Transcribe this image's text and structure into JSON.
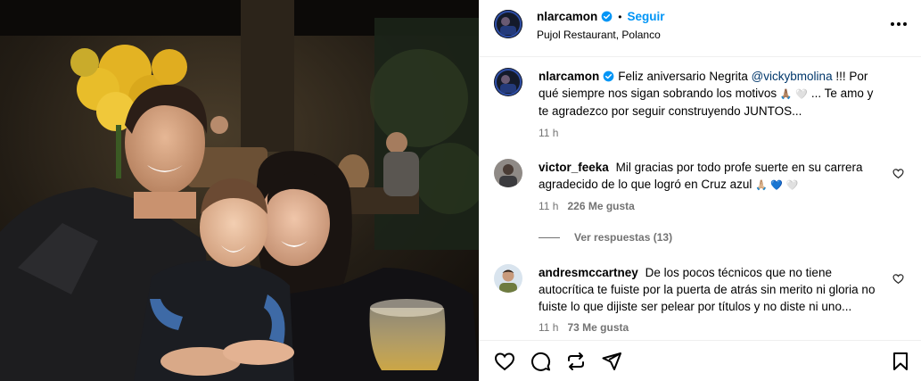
{
  "post": {
    "username": "nlarcamon",
    "follow_label": "Seguir",
    "location": "Pujol Restaurant, Polanco",
    "separator": "•",
    "more_label": "···"
  },
  "caption": {
    "username": "nlarcamon",
    "text_before_mention": "Feliz aniversario Negrita ",
    "mention": "@vickybmolina",
    "text_after_mention": " !!! Por qué siempre nos sigan sobrando los motivos ",
    "emoji_1": "🙏🏽",
    "emoji_2": "🤍",
    "text_end": " ... Te amo y te agradezco por seguir construyendo JUNTOS...",
    "time": "11 h"
  },
  "comments": [
    {
      "username": "victor_feeka",
      "text": "Mil gracias por todo profe suerte en su carrera agradecido de lo que logró en Cruz azul ",
      "emojis": "🙏🏼 💙 🤍",
      "time": "11 h",
      "likes": "226 Me gusta"
    },
    {
      "username": "andresmccartney",
      "text": "De los pocos técnicos que no tiene autocrítica te fuiste por la puerta de atrás sin merito ni gloria no fuiste lo que dijiste ser pelear por títulos y no diste ni uno...",
      "time": "11 h",
      "likes": "73 Me gusta"
    }
  ],
  "replies_label": "Ver respuestas (13)",
  "colors": {
    "link_blue": "#0095f6",
    "verified_blue": "#0095f6",
    "mention": "#00376b",
    "muted": "#737373"
  },
  "icons": [
    "verified-badge-icon",
    "more-options-icon",
    "heart-icon",
    "comment-icon",
    "share-icon",
    "send-icon",
    "save-icon"
  ]
}
